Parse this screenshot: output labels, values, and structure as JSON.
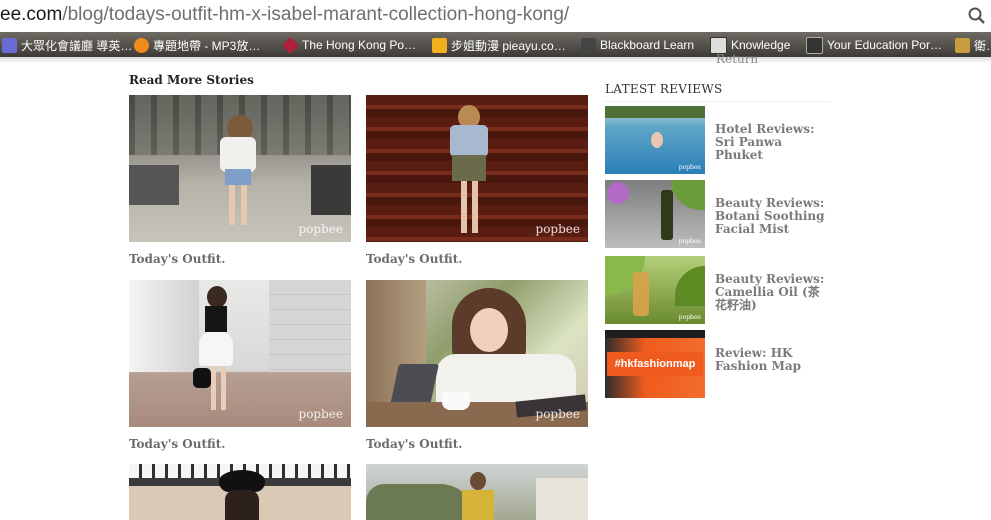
{
  "browser": {
    "url_host": "ee.com",
    "url_path": "/blog/todays-outfit-hm-x-isabel-marant-collection-hong-kong/",
    "bookmarks": [
      {
        "label": "大眾化會議廳 導英…",
        "icon_color": "#6b6bd6"
      },
      {
        "label": "專題地帶 - MP3放…",
        "icon_color": "#f08a1d"
      },
      {
        "label": "The Hong Kong Po…",
        "icon_color": "#b0203a"
      },
      {
        "label": "步姐動漫 pieayu.co…",
        "icon_color": "#f2b01b"
      },
      {
        "label": "Blackboard Learn",
        "icon_color": "#444444"
      },
      {
        "label": "Knowledge",
        "icon_color": "#dddddd"
      },
      {
        "label": "Your Education Por…",
        "icon_color": "#333333"
      },
      {
        "label": "衛…",
        "icon_color": "#c99c3c"
      }
    ]
  },
  "peek_text": "Return",
  "read_more": {
    "title": "Read More Stories",
    "watermark": "popbee",
    "stories": [
      {
        "caption": "Today's Outfit."
      },
      {
        "caption": "Today's Outfit."
      },
      {
        "caption": "Today's Outfit."
      },
      {
        "caption": "Today's Outfit."
      }
    ]
  },
  "latest_reviews": {
    "title": "LATEST REVIEWS",
    "items": [
      {
        "title": "Hotel Reviews: Sri Panwa Phuket"
      },
      {
        "title": "Beauty Reviews: Botani Soothing Facial Mist"
      },
      {
        "title": "Beauty Reviews: Camellia Oil (茶花籽油)"
      },
      {
        "title": "Review: HK Fashion Map",
        "thumb_label": "#hkfashionmap"
      }
    ],
    "thumb_watermark": "popbee"
  }
}
